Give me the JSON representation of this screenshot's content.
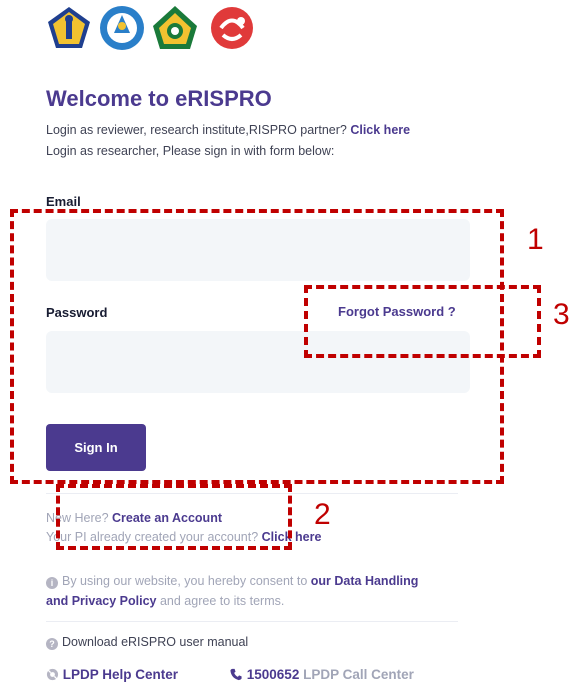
{
  "header": {
    "title": "Welcome to eRISPRO",
    "intro_line1_text": "Login as reviewer, research institute,RISPRO partner?",
    "intro_line1_link": "Click here",
    "intro_line2": "Login as researcher, Please sign in with form below:"
  },
  "form": {
    "email_label": "Email",
    "email_value": "",
    "password_label": "Password",
    "password_value": "",
    "forgot_link": "Forgot Password ?",
    "signin_button": "Sign In"
  },
  "signup": {
    "new_here": "New Here?",
    "create_account": "Create an Account",
    "pi_created": "Your PI already created your account?",
    "pi_link": "Click here"
  },
  "consent": {
    "info_icon": "info-icon",
    "text_before": "By using our website, you hereby consent to",
    "policy_link_part1": "our Data Handling",
    "policy_link_part2": "and Privacy Policy",
    "text_after": "and agree to its terms."
  },
  "manual": {
    "icon": "question-icon",
    "text": "Download eRISPRO user manual"
  },
  "footer": {
    "help_icon": "lifebuoy-icon",
    "help_center": "LPDP Help Center",
    "phone_icon": "phone-icon",
    "phone_number": "1500652",
    "call_center": "LPDP Call Center"
  },
  "annotations": {
    "marker1": "1",
    "marker2": "2",
    "marker3": "3",
    "color": "#c00000"
  },
  "colors": {
    "primary": "#4b3a8f",
    "input_bg": "#f3f6f9",
    "muted": "#a1a5b7"
  },
  "logos": [
    "kemenkeu-logo",
    "tut-wuri-handayani-logo",
    "kemenag-logo",
    "lpdp-logo"
  ]
}
